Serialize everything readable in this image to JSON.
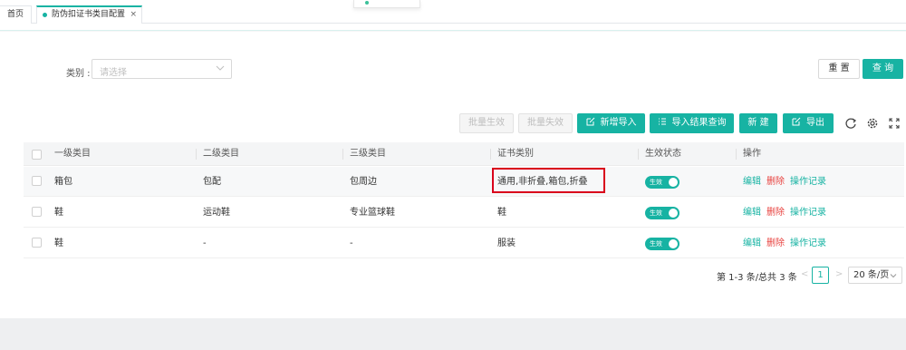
{
  "tabs": [
    {
      "label": "首页",
      "active": false
    },
    {
      "label": "防伪扣证书类目配置",
      "active": true
    }
  ],
  "filter": {
    "label": "类别 :",
    "placeholder": "请选择"
  },
  "actions": {
    "reset": "重 置",
    "search": "查 询",
    "batch_enable": "批量生效",
    "batch_disable": "批量失效",
    "add_import": "新增导入",
    "import_result": "导入结果查询",
    "new": "新 建",
    "export": "导出"
  },
  "toolbar_icons": [
    "refresh-icon",
    "settings-icon",
    "fullscreen-icon"
  ],
  "table": {
    "headers": [
      "一级类目",
      "二级类目",
      "三级类目",
      "证书类别",
      "生效状态",
      "操作"
    ],
    "rows": [
      {
        "level1": "箱包",
        "level2": "包配",
        "level3": "包周边",
        "cert": "通用,非折叠,箱包,折叠",
        "status": "生效",
        "enabled": true
      },
      {
        "level1": "鞋",
        "level2": "运动鞋",
        "level3": "专业篮球鞋",
        "cert": "鞋",
        "status": "生效",
        "enabled": true
      },
      {
        "level1": "鞋",
        "level2": "-",
        "level3": "-",
        "cert": "服装",
        "status": "生效",
        "enabled": true
      }
    ],
    "ops": {
      "edit": "编辑",
      "delete": "删除",
      "log": "操作记录"
    }
  },
  "pagination": {
    "total": "第 1-3 条/总共 3 条",
    "prev": "<",
    "current": "1",
    "next": ">",
    "page_size": "20 条/页"
  },
  "colors": {
    "accent": "#17b3a3",
    "danger": "#e8423f",
    "highlight_box": "#d9001b"
  }
}
